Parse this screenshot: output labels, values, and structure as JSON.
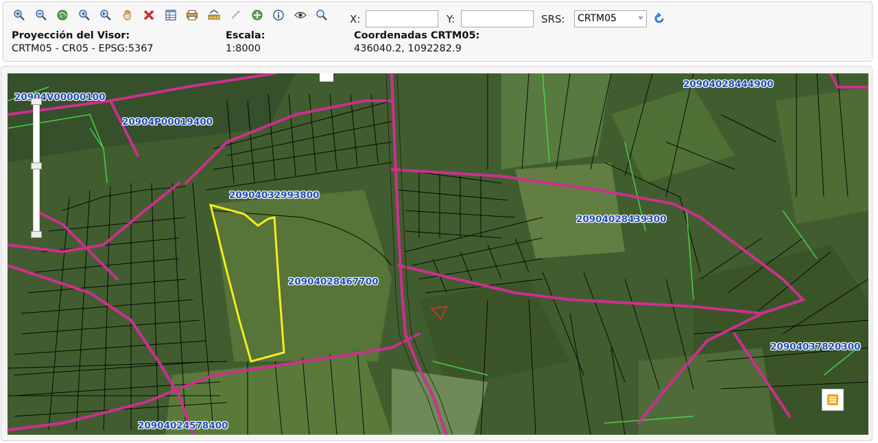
{
  "toolbar": {
    "tools": [
      "zoom-in-icon",
      "zoom-out-icon",
      "globe-icon",
      "zoom-previous-icon",
      "zoom-next-icon",
      "pan-hand-icon",
      "clear-icon",
      "table-icon",
      "print-icon",
      "measure-icon",
      "draw-line-icon",
      "identify-icon",
      "info-icon",
      "eye-icon",
      "search-icon"
    ],
    "x_label": "X:",
    "y_label": "Y:",
    "x_value": "",
    "y_value": "",
    "srs_label": "SRS:",
    "srs_selected": "CRTM05"
  },
  "info": {
    "projection_label": "Proyección del Visor:",
    "projection_value": "CRTM05 - CR05 - EPSG:5367",
    "scale_label": "Escala:",
    "scale_value": "1:8000",
    "coords_label": "Coordenadas CRTM05:",
    "coords_value": "436040.2, 1092282.9"
  },
  "map": {
    "parcel_labels": [
      "20904V00000100",
      "20904P00019400",
      "20904032993800",
      "20904028467700",
      "20904028439300",
      "20904028444900",
      "20904037820300",
      "20904024578400"
    ],
    "zoom_level_fraction": 0.52,
    "colors": {
      "parcel_lines": "#000000",
      "roads": "#cc2f8f",
      "highlight": "#f4ee1b",
      "green_lines": "#4ad14a",
      "label_text": "#1f4fb8"
    }
  }
}
